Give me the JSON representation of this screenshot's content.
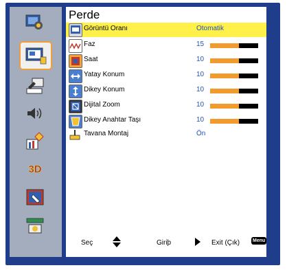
{
  "menu_title": "Perde",
  "rows": [
    {
      "label": "Görüntü Oranı",
      "value": "Otomatik",
      "icon": "aspect-ratio-icon"
    },
    {
      "label": "Faz",
      "value": "15",
      "level": 0.6,
      "icon": "phase-icon"
    },
    {
      "label": "Saat",
      "value": "10",
      "level": 0.6,
      "icon": "clock-icon"
    },
    {
      "label": "Yatay Konum",
      "value": "10",
      "level": 0.6,
      "icon": "horizontal-position-icon"
    },
    {
      "label": "Dikey Konum",
      "value": "10",
      "level": 0.6,
      "icon": "vertical-position-icon"
    },
    {
      "label": "Dijital Zoom",
      "value": "10",
      "level": 0.6,
      "icon": "digital-zoom-icon"
    },
    {
      "label": "Dikey Anahtar Taşı",
      "value": "10",
      "level": 0.6,
      "icon": "keystone-icon"
    },
    {
      "label": "Tavana Montaj",
      "value": "Ön",
      "icon": "ceiling-mount-icon"
    }
  ],
  "sidebar": [
    {
      "icon": "image-settings-icon"
    },
    {
      "icon": "display-icon",
      "active": true
    },
    {
      "icon": "setup-icon"
    },
    {
      "icon": "volume-icon"
    },
    {
      "icon": "options-icon"
    },
    {
      "icon": "3d-icon",
      "text": "3D"
    },
    {
      "icon": "lamp-icon"
    },
    {
      "icon": "network-icon"
    }
  ],
  "footer": {
    "select": "Seç",
    "enter": "Giriþ",
    "exit": "Exit (Çık)",
    "menu_key": "Menu"
  },
  "colors": {
    "background": "#1f3d8a",
    "sidebar": "#a4adbd",
    "selection": "#fff04a",
    "bar_fill": "#f19a2e",
    "value_text": "#2152b8",
    "active_border": "#f19e38"
  }
}
